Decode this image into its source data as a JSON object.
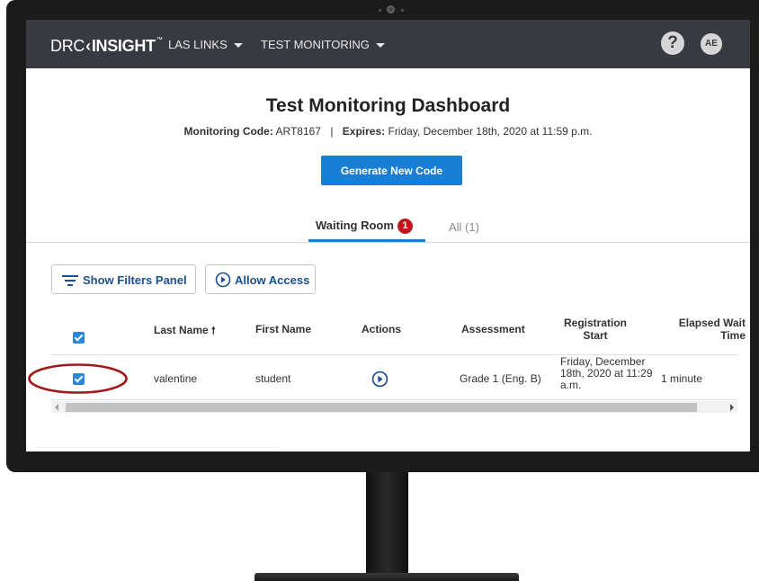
{
  "navbar": {
    "logo_drc": "DRC",
    "logo_chevron": "‹",
    "logo_insight": "INSIGHT",
    "logo_tm": "™",
    "menu_las_links": "LAS LINKS",
    "menu_test_monitoring": "TEST MONITORING",
    "help_symbol": "?",
    "user_initials": "AE"
  },
  "header": {
    "title": "Test Monitoring Dashboard",
    "monitoring_code_label": "Monitoring Code:",
    "monitoring_code_value": "ART8167",
    "separator": "|",
    "expires_label": "Expires:",
    "expires_value": "Friday, December 18th, 2020 at 11:59 p.m.",
    "generate_button": "Generate New Code"
  },
  "tabs": {
    "waiting_room": "Waiting Room",
    "waiting_count": "1",
    "all": "All (1)"
  },
  "toolbar": {
    "show_filters": "Show Filters Panel",
    "allow_access": "Allow Access"
  },
  "table": {
    "headers": {
      "last_name": "Last Name",
      "sort_arrow": "🠕",
      "first_name": "First Name",
      "actions": "Actions",
      "assessment": "Assessment",
      "registration_start_line1": "Registration",
      "registration_start_line2": "Start",
      "elapsed_wait_line1": "Elapsed Wait",
      "elapsed_wait_line2": "Time"
    },
    "rows": [
      {
        "last_name": "valentine",
        "first_name": "student",
        "assessment": "Grade 1 (Eng. B)",
        "registration_start": "Friday, December 18th, 2020 at 11:29 a.m.",
        "elapsed_wait": "1 minute",
        "selected": true
      }
    ]
  },
  "colors": {
    "navbar": "#383a40",
    "primary": "#1a7fd4",
    "badge": "#c0171c",
    "annotation": "#a01a1a"
  },
  "icons": {
    "filter": "filter-icon",
    "play_circle": "play-circle-icon",
    "help": "help-icon",
    "sort": "sort-ascending-icon"
  }
}
